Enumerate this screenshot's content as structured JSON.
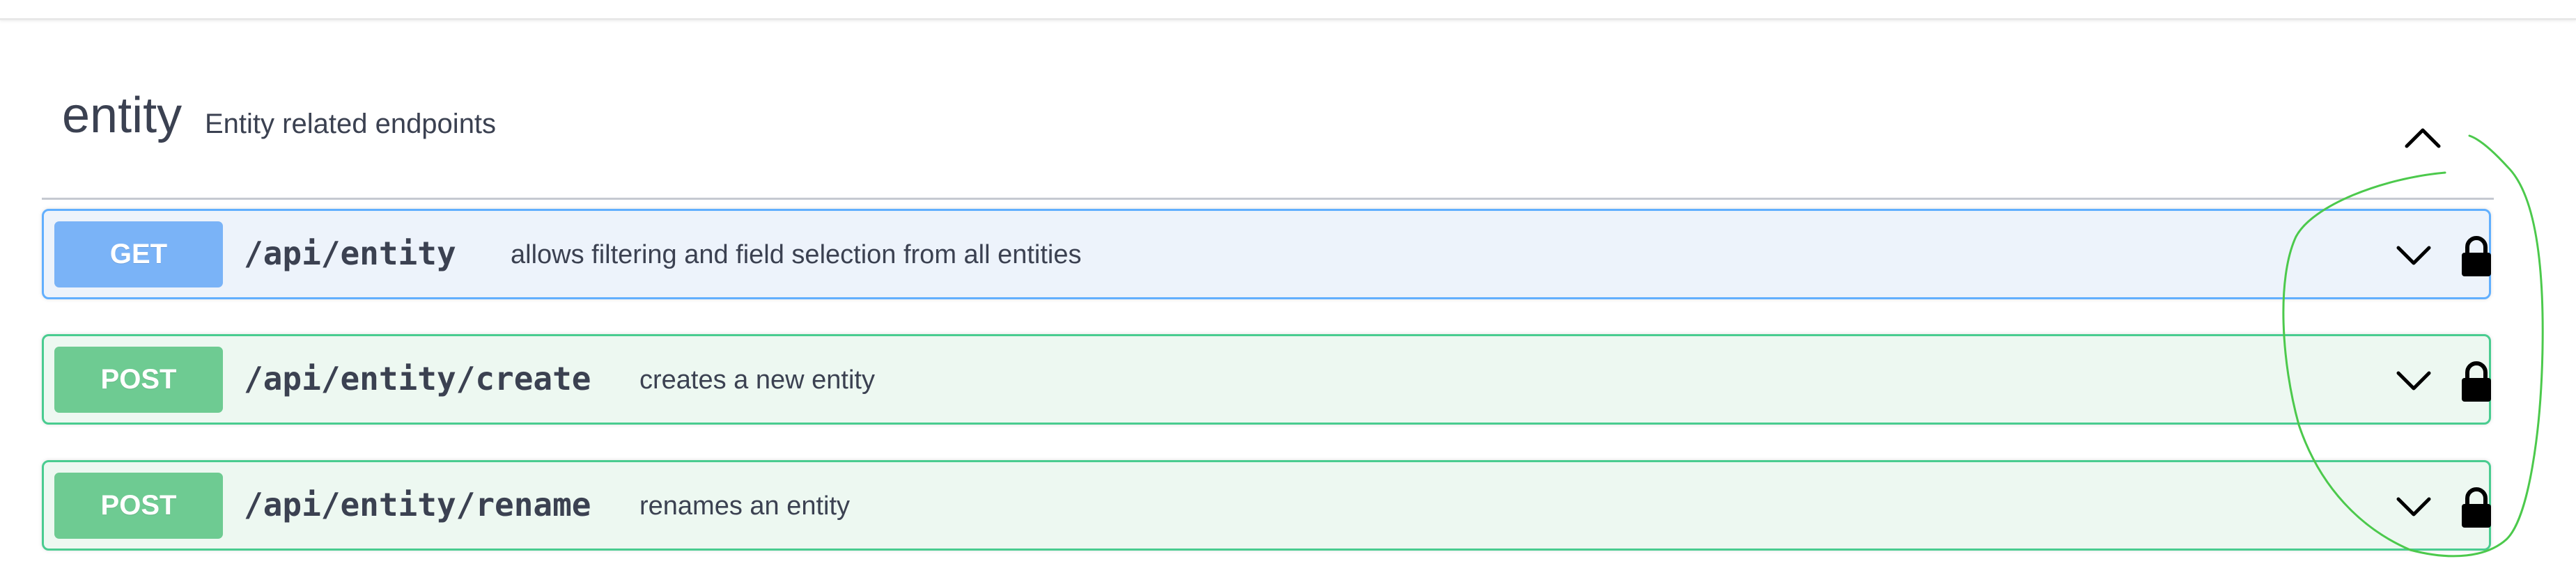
{
  "tag": {
    "name": "entity",
    "description": "Entity related endpoints"
  },
  "operations": [
    {
      "method": "GET",
      "path": "/api/entity",
      "summary": "allows filtering and field selection from all entities"
    },
    {
      "method": "POST",
      "path": "/api/entity/create",
      "summary": "creates a new entity"
    },
    {
      "method": "POST",
      "path": "/api/entity/rename",
      "summary": "renames an entity"
    }
  ],
  "icons": {
    "collapse": "chevron-up-icon",
    "expand": "chevron-down-icon",
    "authorize": "lock-icon"
  },
  "colors": {
    "get_accent": "#61affe",
    "post_accent": "#49cc90",
    "annotation": "#4cc94c"
  }
}
